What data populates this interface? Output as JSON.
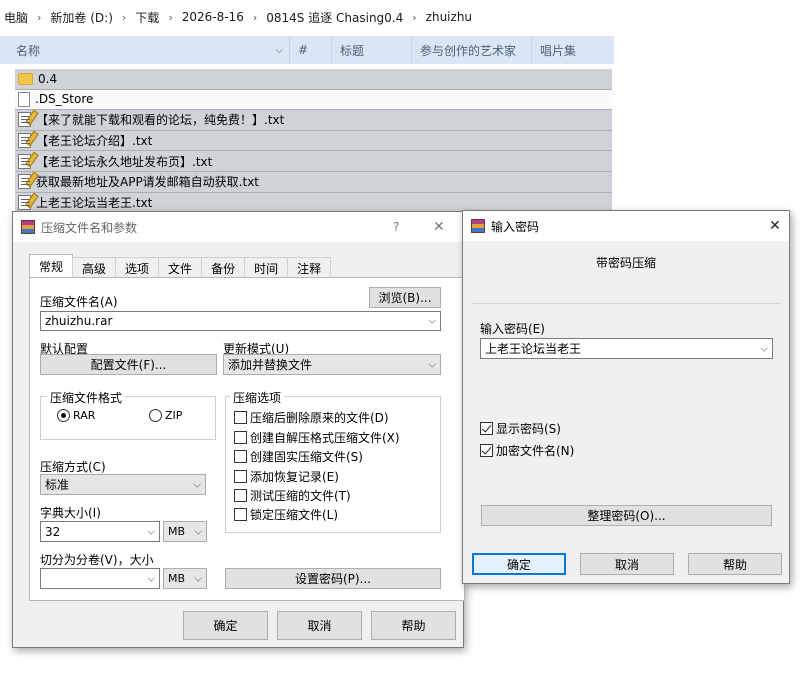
{
  "explorer": {
    "breadcrumb": [
      "电脑",
      "新加卷 (D:)",
      "下载",
      "2026-8-16",
      "0814S 追逐 Chasing0.4",
      "zhuizhu"
    ],
    "columns": [
      "名称",
      "#",
      "标题",
      "参与创作的艺术家",
      "唱片集"
    ],
    "files": [
      {
        "name": "0.4",
        "icon": "folder-icon"
      },
      {
        "name": ".DS_Store",
        "icon": "file-icon"
      },
      {
        "name": "【来了就能下载和观看的论坛，纯免费！】.txt",
        "icon": "text-file-icon"
      },
      {
        "name": "【老王论坛介绍】.txt",
        "icon": "text-file-icon"
      },
      {
        "name": "【老王论坛永久地址发布页】.txt",
        "icon": "text-file-icon"
      },
      {
        "name": "获取最新地址及APP请发邮箱自动获取.txt",
        "icon": "text-file-icon"
      },
      {
        "name": "上老王论坛当老王.txt",
        "icon": "text-file-icon"
      }
    ]
  },
  "archive_dialog": {
    "title": "压缩文件名和参数",
    "help_glyph": "?",
    "close_glyph": "✕",
    "tabs": [
      "常规",
      "高级",
      "选项",
      "文件",
      "备份",
      "时间",
      "注释"
    ],
    "archive_name_label": "压缩文件名(A)",
    "browse_button": "浏览(B)...",
    "archive_name_value": "zhuizhu.rar",
    "default_profile_label": "默认配置",
    "profiles_button": "配置文件(F)...",
    "update_mode_label": "更新模式(U)",
    "update_mode_value": "添加并替换文件",
    "format_group": "压缩文件格式",
    "format_rar": "RAR",
    "format_zip": "ZIP",
    "options_group": "压缩选项",
    "options": [
      {
        "label": "压缩后删除原来的文件(D)",
        "checked": false
      },
      {
        "label": "创建自解压格式压缩文件(X)",
        "checked": false
      },
      {
        "label": "创建固实压缩文件(S)",
        "checked": false
      },
      {
        "label": "添加恢复记录(E)",
        "checked": false
      },
      {
        "label": "测试压缩的文件(T)",
        "checked": false
      },
      {
        "label": "锁定压缩文件(L)",
        "checked": false
      }
    ],
    "method_label": "压缩方式(C)",
    "method_value": "标准",
    "dict_label": "字典大小(I)",
    "dict_value": "32",
    "dict_unit": "MB",
    "split_label": "切分为分卷(V)，大小",
    "split_value": "",
    "split_unit": "MB",
    "set_password_button": "设置密码(P)...",
    "ok_button": "确定",
    "cancel_button": "取消",
    "help_button": "帮助"
  },
  "password_dialog": {
    "title": "输入密码",
    "close_glyph": "✕",
    "heading": "带密码压缩",
    "password_label": "输入密码(E)",
    "password_value": "上老王论坛当老王",
    "show_password_label": "显示密码(S)",
    "show_password_checked": true,
    "encrypt_names_label": "加密文件名(N)",
    "encrypt_names_checked": true,
    "organize_button": "整理密码(O)...",
    "ok_button": "确定",
    "cancel_button": "取消",
    "help_button": "帮助"
  }
}
